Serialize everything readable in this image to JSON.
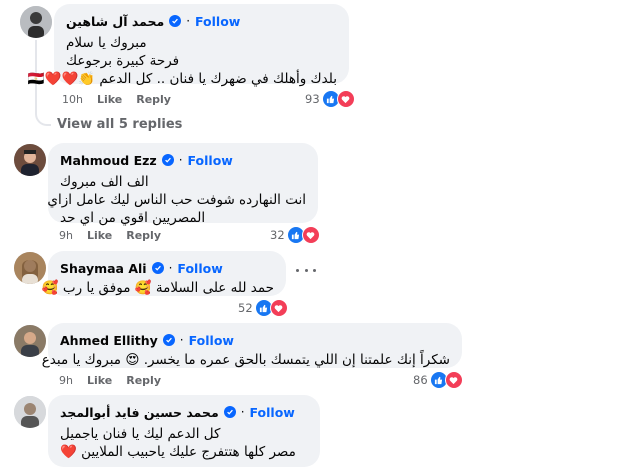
{
  "comments": [
    {
      "name": "محمد آل شاهين",
      "follow": "Follow",
      "lines": [
        "مبروك يا سلام",
        "فرحة كبيرة برجوعك",
        "بلدك وأهلك في ضهرك يا فنان .. كل الدعم 👏❤️❤️🇪🇬"
      ],
      "time": "10h",
      "like": "Like",
      "reply": "Reply",
      "reaction_count": "93"
    },
    {
      "name": "Mahmoud Ezz",
      "follow": "Follow",
      "lines": [
        "الف الف مبروك",
        "انت النهارده شوفت حب الناس ليك عامل ازاي",
        "المصريين اقوي من اي حد"
      ],
      "time": "9h",
      "like": "Like",
      "reply": "Reply",
      "reaction_count": "32"
    },
    {
      "name": "Shaymaa Ali",
      "follow": "Follow",
      "lines": [
        "حمد لله على السلامة 🥰 موفق يا رب 🥰"
      ],
      "time": "9h",
      "like": "Like",
      "reply": "Reply",
      "reaction_count": "52"
    },
    {
      "name": "Ahmed Ellithy",
      "follow": "Follow",
      "lines": [
        "شكراً إنك علمتنا إن اللي يتمسك بالحق عمره ما يخسر. 😍 مبروك يا مبدع"
      ],
      "time": "9h",
      "like": "Like",
      "reply": "Reply",
      "reaction_count": "86"
    },
    {
      "name": "محمد حسين فايد أبوالمجد",
      "follow": "Follow",
      "lines": [
        "كل الدعم ليك يا فنان ياجميل",
        "مصر كلها هتتفرج عليك ياحبيب الملايين ❤️"
      ]
    }
  ],
  "view_replies": "View all 5 replies",
  "dot": "·",
  "icons": {
    "verified": "verified-check-icon",
    "like": "like-reaction-icon",
    "love": "love-reaction-icon",
    "more": "more-options-icon"
  },
  "colors": {
    "accent": "#0866ff",
    "muted": "#65676b",
    "bubble": "#f0f2f5",
    "love": "#f33e58"
  }
}
